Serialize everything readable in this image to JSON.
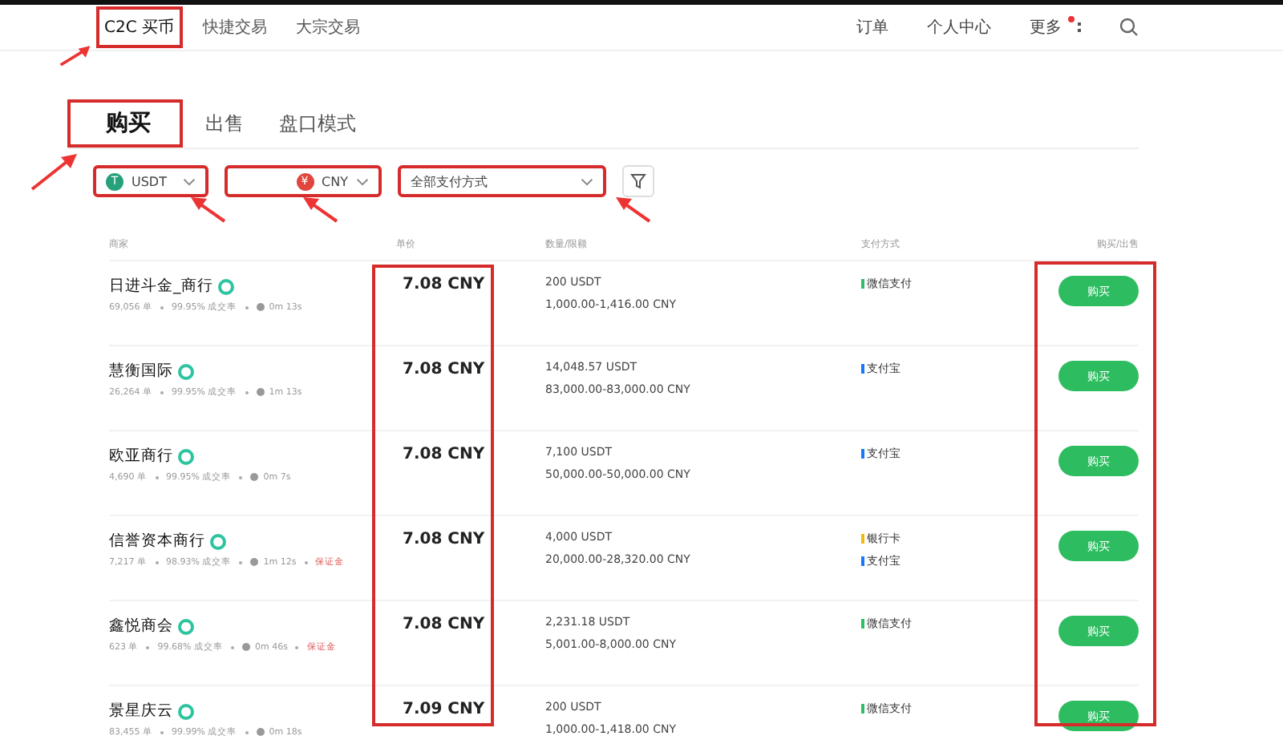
{
  "nav": {
    "items": [
      {
        "label": "C2C 买币",
        "selected": true,
        "highlighted": true
      },
      {
        "label": "快捷交易",
        "selected": false,
        "highlighted": false
      },
      {
        "label": "大宗交易",
        "selected": false,
        "highlighted": false
      }
    ],
    "right": [
      {
        "label": "订单",
        "badge": false
      },
      {
        "label": "个人中心",
        "badge": false
      },
      {
        "label": "更多",
        "badge": true
      }
    ]
  },
  "tabs": [
    {
      "label": "购买",
      "selected": true,
      "highlighted": true
    },
    {
      "label": "出售",
      "selected": false,
      "highlighted": false
    },
    {
      "label": "盘口模式",
      "selected": false,
      "highlighted": false
    }
  ],
  "filters": [
    {
      "kind": "coin",
      "symbol": "T",
      "color": "#26a17b",
      "value": "USDT",
      "highlighted": true
    },
    {
      "kind": "amount",
      "symbol": "¥",
      "color": "#e0463d",
      "value": "CNY",
      "highlighted": true
    },
    {
      "kind": "payment",
      "value": "全部支付方式",
      "highlighted": true
    }
  ],
  "columns": [
    "商家",
    "单价",
    "数量/限额",
    "支付方式",
    "购买/出售"
  ],
  "highlight_columns": {
    "price": true,
    "action": true
  },
  "rows": [
    {
      "merchant": "日进斗金_商行",
      "verified": true,
      "orders": "69,056 单",
      "rate": "99.95% 成交率",
      "time": "0m 13s",
      "deposit": "",
      "price": "7.08 CNY",
      "quantity": "200 USDT",
      "limit": "1,000.00-1,416.00 CNY",
      "payments": [
        {
          "label": "微信支付",
          "color": "#2dbf63"
        }
      ],
      "action": "购买"
    },
    {
      "merchant": "慧衡国际",
      "verified": true,
      "orders": "26,264 单",
      "rate": "99.95% 成交率",
      "time": "1m 13s",
      "deposit": "",
      "price": "7.08 CNY",
      "quantity": "14,048.57 USDT",
      "limit": "83,000.00-83,000.00 CNY",
      "payments": [
        {
          "label": "支付宝",
          "color": "#1677ff"
        }
      ],
      "action": "购买"
    },
    {
      "merchant": "欧亚商行",
      "verified": true,
      "orders": "4,690 单",
      "rate": "99.95% 成交率",
      "time": "0m 7s",
      "deposit": "",
      "price": "7.08 CNY",
      "quantity": "7,100 USDT",
      "limit": "50,000.00-50,000.00 CNY",
      "payments": [
        {
          "label": "支付宝",
          "color": "#1677ff"
        }
      ],
      "action": "购买"
    },
    {
      "merchant": "信誉资本商行",
      "verified": true,
      "orders": "7,217 单",
      "rate": "98.93% 成交率",
      "time": "1m 12s",
      "deposit": "保证金",
      "price": "7.08 CNY",
      "quantity": "4,000 USDT",
      "limit": "20,000.00-28,320.00 CNY",
      "payments": [
        {
          "label": "银行卡",
          "color": "#f0b90b"
        },
        {
          "label": "支付宝",
          "color": "#1677ff"
        }
      ],
      "action": "购买"
    },
    {
      "merchant": "鑫悦商会",
      "verified": true,
      "orders": "623 单",
      "rate": "99.68% 成交率",
      "time": "0m 46s",
      "deposit": "保证金",
      "price": "7.08 CNY",
      "quantity": "2,231.18 USDT",
      "limit": "5,001.00-8,000.00 CNY",
      "payments": [
        {
          "label": "微信支付",
          "color": "#2dbf63"
        }
      ],
      "action": "购买"
    },
    {
      "merchant": "景星庆云",
      "verified": true,
      "orders": "83,455 单",
      "rate": "99.99% 成交率",
      "time": "0m 18s",
      "deposit": "",
      "price": "7.09 CNY",
      "quantity": "200 USDT",
      "limit": "1,000.00-1,418.00 CNY",
      "payments": [
        {
          "label": "微信支付",
          "color": "#2dbf63"
        }
      ],
      "action": "购买"
    }
  ]
}
